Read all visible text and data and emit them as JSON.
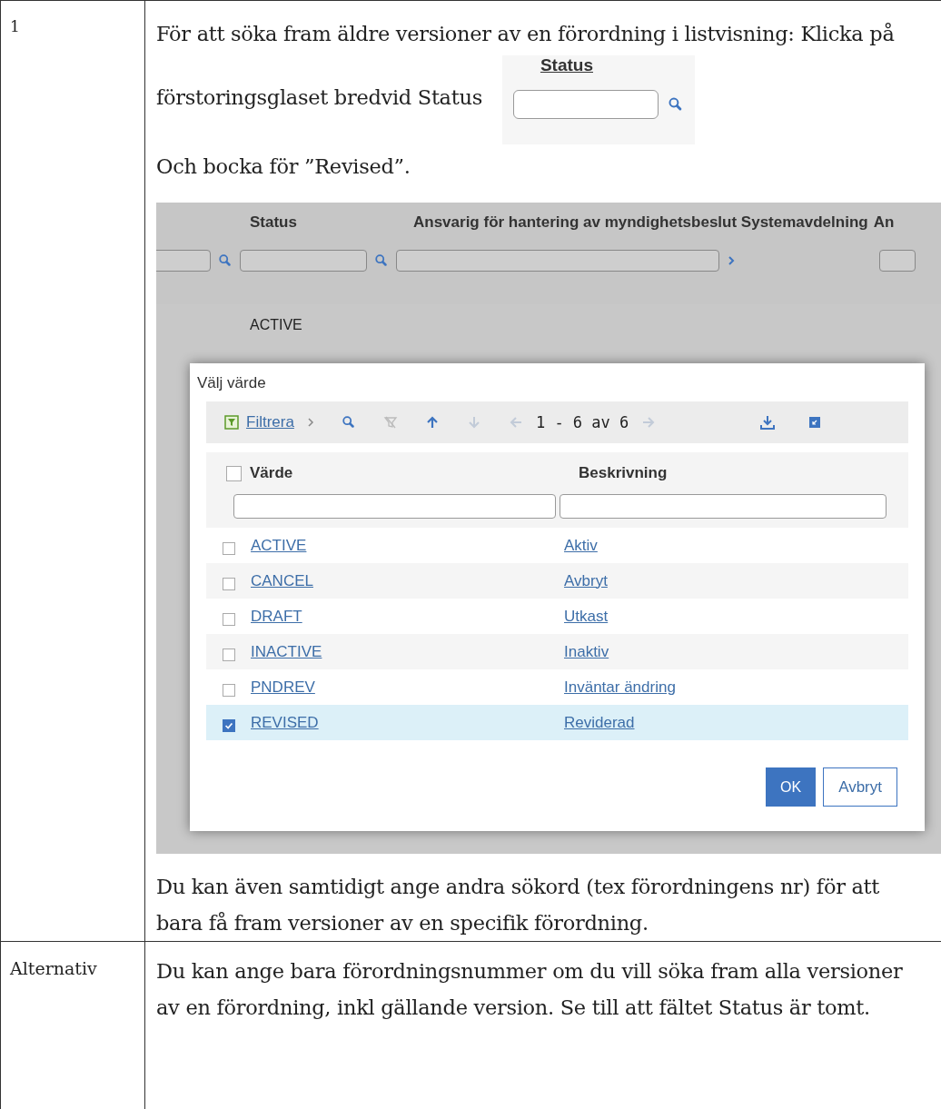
{
  "step": {
    "label": "1",
    "intro": "För att söka fram äldre versioner av en förordning i listvisning: Klicka på",
    "intro_cont": "förstoringsglaset bredvid Status",
    "inset": {
      "heading": "Status"
    },
    "instruction": "Och bocka för ”Revised”.",
    "screenshot": {
      "columns": [
        "Status",
        "Ansvarig för hantering av myndighetsbeslut Systemavdelning",
        "An"
      ],
      "first_cell": "ACTIVE",
      "dialog": {
        "title": "Välj värde",
        "filter_link": "Filtrera",
        "pager": "1 - 6 av 6",
        "header_checked": false,
        "headers": [
          "Värde",
          "Beskrivning"
        ],
        "rows": [
          {
            "value": "ACTIVE",
            "description": "Aktiv",
            "checked": false,
            "selected": false
          },
          {
            "value": "CANCEL",
            "description": "Avbryt",
            "checked": false,
            "selected": false
          },
          {
            "value": "DRAFT",
            "description": "Utkast",
            "checked": false,
            "selected": false
          },
          {
            "value": "INACTIVE",
            "description": "Inaktiv",
            "checked": false,
            "selected": false
          },
          {
            "value": "PNDREV",
            "description": "Inväntar ändring",
            "checked": false,
            "selected": false
          },
          {
            "value": "REVISED",
            "description": "Reviderad",
            "checked": true,
            "selected": true
          }
        ],
        "buttons": [
          "OK",
          "Avbryt"
        ]
      }
    },
    "note": "Du kan även samtidigt ange andra sökord (tex förordningens nr) för att bara få fram versioner av en specifik förordning."
  },
  "alternative": {
    "label": "Alternativ",
    "text": "Du kan ange bara förordningsnummer om du vill söka fram alla versioner av en förordning, inkl gällande version. Se till att fältet Status är tomt."
  }
}
